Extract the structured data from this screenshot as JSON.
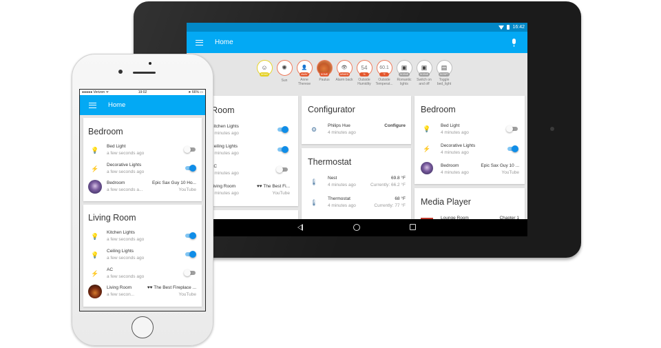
{
  "tablet": {
    "status_time": "16:42",
    "app_title": "Home",
    "badges": [
      {
        "label": "",
        "tag": "DEMO",
        "icon": "smiley-icon",
        "glyph": "☺",
        "style": "demo"
      },
      {
        "label": "Sun",
        "tag": "",
        "icon": "sun-icon",
        "glyph": "✺",
        "style": ""
      },
      {
        "label": "Anne Therese",
        "tag": "AWAY",
        "icon": "person-icon",
        "glyph": "👤",
        "style": ""
      },
      {
        "label": "Paulus",
        "tag": "HOME",
        "icon": "profile-photo",
        "glyph": "",
        "style": "photo"
      },
      {
        "label": "Alarm back",
        "tag": "ARMED",
        "icon": "eye-icon",
        "glyph": "👁",
        "style": ""
      },
      {
        "label": "Outside Humidity",
        "tag": "%",
        "icon": "value",
        "glyph": "54",
        "style": ""
      },
      {
        "label": "Outside Temperat...",
        "tag": "°F",
        "icon": "value",
        "glyph": "60.1",
        "style": ""
      },
      {
        "label": "Romantic lights",
        "tag": "SCENE",
        "icon": "scene-icon",
        "glyph": "▣",
        "style": "scene"
      },
      {
        "label": "Switch on and off",
        "tag": "SCENE",
        "icon": "scene-icon",
        "glyph": "▣",
        "style": "scene"
      },
      {
        "label": "Toggle bed_light",
        "tag": "SCRIPT",
        "icon": "script-icon",
        "glyph": "▤",
        "style": "scene"
      }
    ],
    "living_room": {
      "title": "Living Room",
      "rows": [
        {
          "name": "Kitchen Lights",
          "sub": "4 minutes ago",
          "state": "on"
        },
        {
          "name": "Ceiling Lights",
          "sub": "4 minutes ago",
          "state": "on"
        },
        {
          "name": "AC",
          "sub": "4 minutes ago",
          "state": "off"
        },
        {
          "name": "Living Room",
          "sub": "4 minutes ago",
          "right": "♥♥ The Best Fi...",
          "right2": "YouTube"
        }
      ]
    },
    "configurator": {
      "title": "Configurator",
      "row": {
        "name": "Philips Hue",
        "sub": "4 minutes ago",
        "action": "Configure"
      }
    },
    "thermostat": {
      "title": "Thermostat",
      "rows": [
        {
          "name": "Nest",
          "sub": "4 minutes ago",
          "target": "69.8 °F",
          "current": "Currently: 66.2 °F"
        },
        {
          "name": "Thermostat",
          "sub": "4 minutes ago",
          "target": "68 °F",
          "current": "Currently: 77 °F"
        }
      ]
    },
    "bedroom": {
      "title": "Bedroom",
      "rows": [
        {
          "name": "Bed Light",
          "sub": "4 minutes ago",
          "state": "off"
        },
        {
          "name": "Decorative Lights",
          "sub": "4 minutes ago",
          "state": "on"
        },
        {
          "name": "Bedroom",
          "sub": "4 minutes ago",
          "right": "Epic Sax Guy 10 ...",
          "right2": "YouTube"
        }
      ]
    },
    "media_player": {
      "title": "Media Player",
      "row": {
        "name": "Lounge Room",
        "right": "Chapter 1"
      }
    }
  },
  "phone": {
    "status": {
      "carrier": "●●●●● Verizon ᯤ",
      "time": "19:02",
      "battery": "➤ 66% ▭"
    },
    "app_title": "Home",
    "bedroom": {
      "title": "Bedroom",
      "rows": [
        {
          "name": "Bed Light",
          "sub": "a few seconds ago",
          "state": "off"
        },
        {
          "name": "Decorative Lights",
          "sub": "a few seconds ago",
          "state": "on"
        },
        {
          "name": "Bedroom",
          "sub": "a few seconds a...",
          "right": "Epic Sax Guy 10 Ho...",
          "right2": "YouTube"
        }
      ]
    },
    "living_room": {
      "title": "Living Room",
      "rows": [
        {
          "name": "Kitchen Lights",
          "sub": "a few seconds ago",
          "state": "on"
        },
        {
          "name": "Ceiling Lights",
          "sub": "a few seconds ago",
          "state": "on"
        },
        {
          "name": "AC",
          "sub": "a few seconds ago",
          "state": "off"
        },
        {
          "name": "Living Room",
          "sub": "a few secon...",
          "right": "♥♥ The Best Fireplace ...",
          "right2": "YouTube"
        }
      ]
    }
  },
  "colors": {
    "primary": "#03a9f4",
    "status_bar": "#0288c7",
    "toggle_on": "#0f8de8",
    "badge_alert": "#e4572e",
    "badge_demo": "#e3cf1c",
    "badge_scene": "#9e9e9e"
  }
}
